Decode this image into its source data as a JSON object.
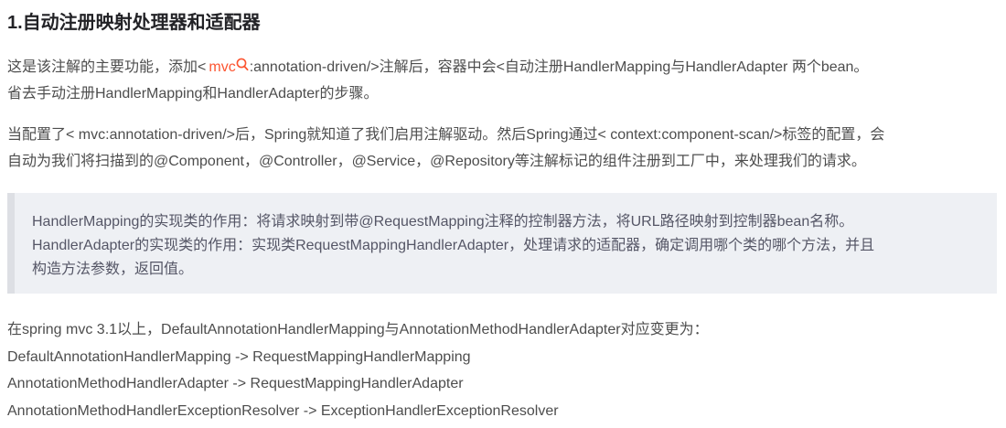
{
  "heading": "1.自动注册映射处理器和适配器",
  "para1": {
    "before_link": "这是该注解的主要功能，添加<",
    "link_text": "mvc",
    "after_link": ":annotation-driven/>注解后，容器中会<自动注册HandlerMapping与HandlerAdapter 两个bean。",
    "line2": "省去手动注册HandlerMapping和HandlerAdapter的步骤。",
    "link_icon": "search-icon",
    "link_color": "#fc5531"
  },
  "para2": {
    "line1": "当配置了< mvc:annotation-driven/>后，Spring就知道了我们启用注解驱动。然后Spring通过< context:component-scan/>标签的配置，会",
    "line2": "自动为我们将扫描到的@Component，@Controller，@Service，@Repository等注解标记的组件注册到工厂中，来处理我们的请求。"
  },
  "blockquote": {
    "line1": "HandlerMapping的实现类的作用：将请求映射到带@RequestMapping注释的控制器方法，将URL路径映射到控制器bean名称。",
    "line2": "HandlerAdapter的实现类的作用：实现类RequestMappingHandlerAdapter，处理请求的适配器，确定调用哪个类的哪个方法，并且",
    "line3": "构造方法参数，返回值。",
    "background": "#eef0f4",
    "border_color": "#dddfe4"
  },
  "para3": {
    "line1": "在spring mvc 3.1以上，DefaultAnnotationHandlerMapping与AnnotationMethodHandlerAdapter对应变更为：",
    "line2": "DefaultAnnotationHandlerMapping -> RequestMappingHandlerMapping",
    "line3": "AnnotationMethodHandlerAdapter -> RequestMappingHandlerAdapter",
    "line4": "AnnotationMethodHandlerExceptionResolver -> ExceptionHandlerExceptionResolver"
  }
}
